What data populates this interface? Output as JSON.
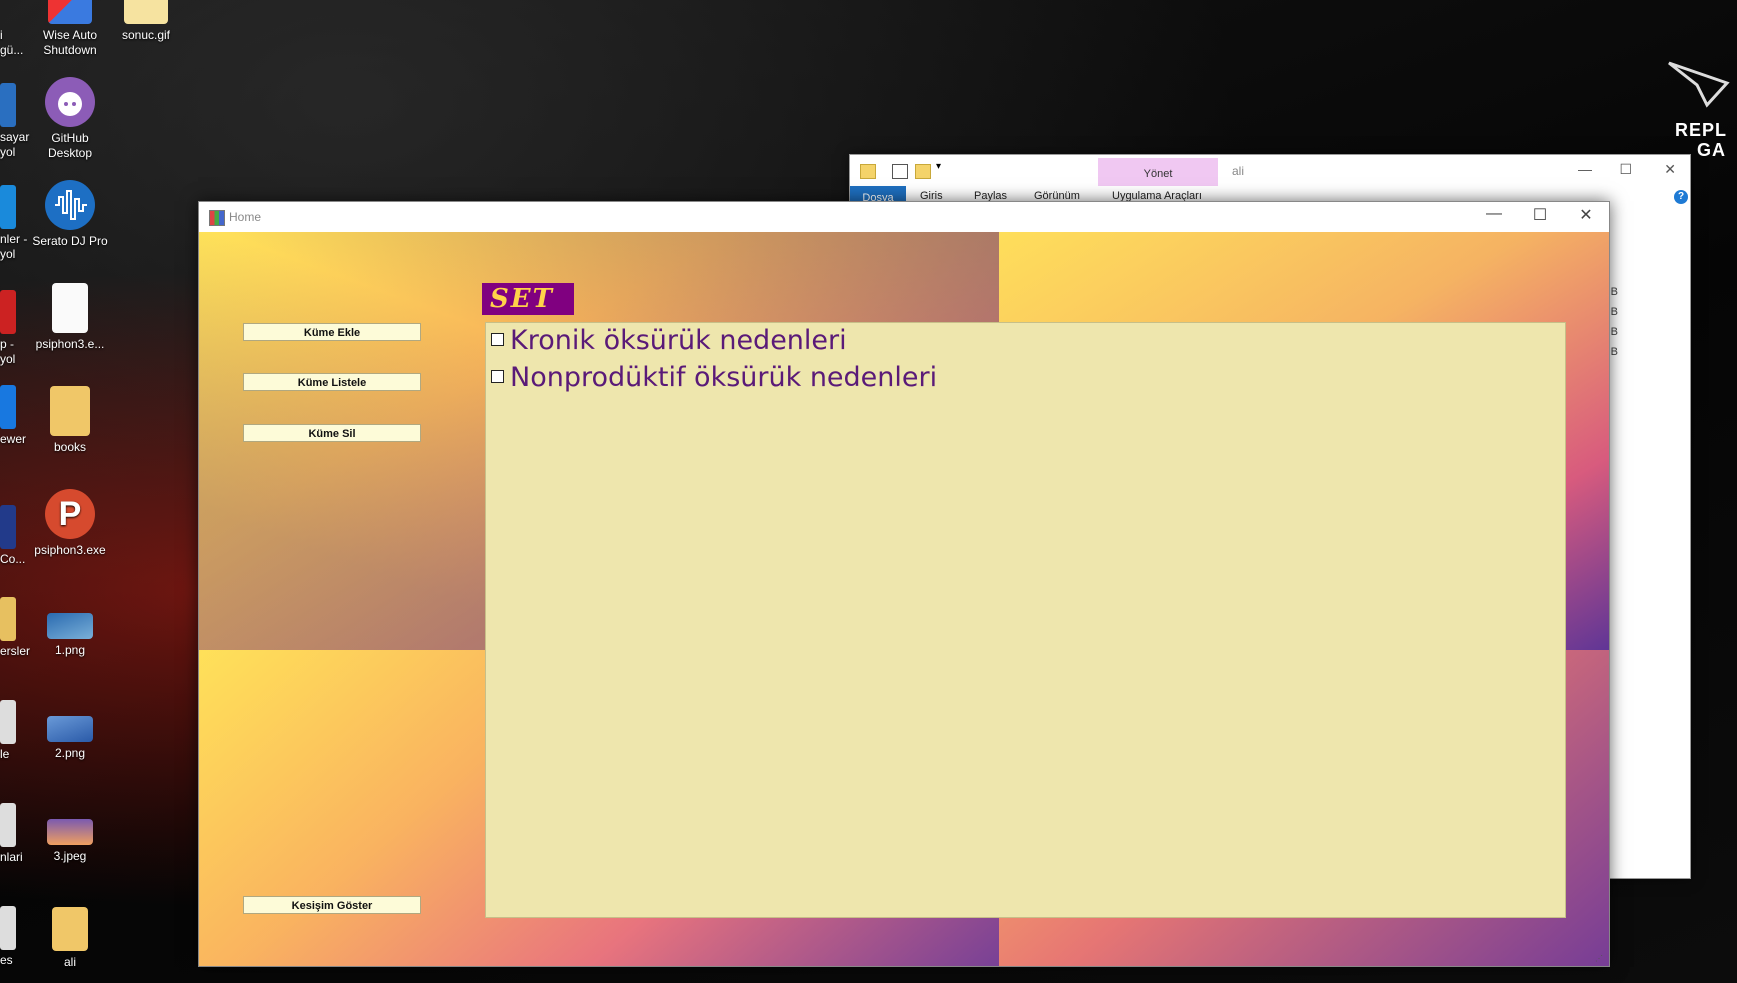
{
  "desktop": {
    "icons": [
      {
        "label": "Wise Auto Shutdown",
        "icon": "wise-auto-shutdown-icon"
      },
      {
        "label": "sonuc.gif",
        "icon": "gif-file-icon"
      },
      {
        "label": "GitHub Desktop",
        "icon": "github-icon"
      },
      {
        "label": "Serato DJ Pro",
        "icon": "serato-icon"
      },
      {
        "label": "psiphon3.e...",
        "icon": "file-icon"
      },
      {
        "label": "books",
        "icon": "folder-icon"
      },
      {
        "label": "psiphon3.exe",
        "icon": "psiphon-icon"
      },
      {
        "label": "1.png",
        "icon": "image-icon"
      },
      {
        "label": "2.png",
        "icon": "image-icon"
      },
      {
        "label": "3.jpeg",
        "icon": "image-icon"
      },
      {
        "label": "ali",
        "icon": "folder-icon"
      }
    ],
    "partial_labels": [
      "i",
      "gü...",
      "sayar",
      "yol",
      "nler -",
      "yol",
      "p -",
      "yol",
      "ewer",
      "Co...",
      "ersler",
      "le",
      "nlari",
      "es"
    ],
    "rog_text": [
      "REPL",
      "GA"
    ]
  },
  "explorer": {
    "title": "ali",
    "manage_tab": "Yönet",
    "ribbon_tabs": [
      "Dosya",
      "Giris",
      "Paylas",
      "Görünüm",
      "Uygulama Araçları"
    ],
    "size_fragments": [
      "B",
      "B",
      "B",
      "B"
    ]
  },
  "home": {
    "title": "Home",
    "buttons": {
      "add": "Küme Ekle",
      "list": "Küme Listele",
      "delete": "Küme Sil",
      "intersection": "Kesişim Göster"
    },
    "set_label": "SET :",
    "list_items": [
      {
        "text": "Kronik öksürük nedenleri",
        "checked": false
      },
      {
        "text": "Nonprodüktif öksürük nedenleri",
        "checked": false
      }
    ]
  },
  "colors": {
    "set_label_bg": "#800080",
    "set_label_fg": "#ffd24a",
    "listbox_bg": "#eee6ad",
    "item_text": "#5a1a78",
    "button_bg": "#fdfbd8"
  }
}
